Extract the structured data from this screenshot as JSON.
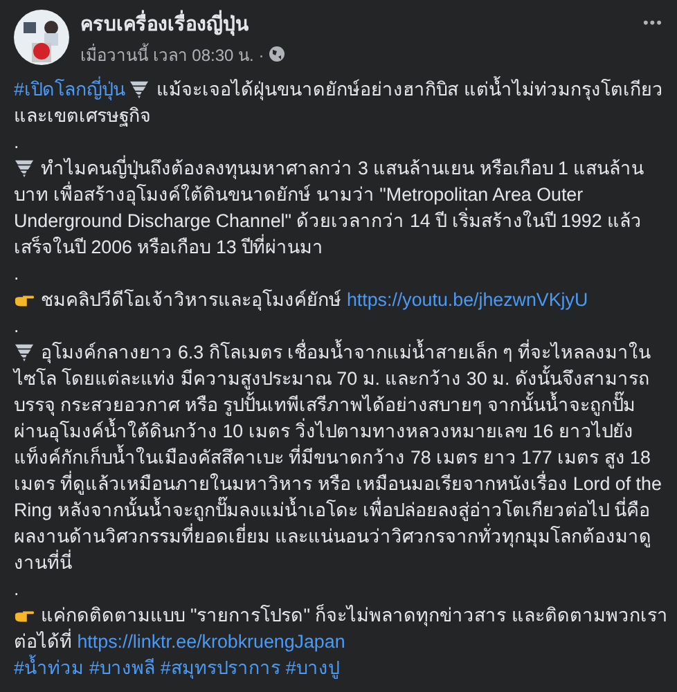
{
  "post": {
    "author": "ครบเครื่องเรื่องญี่ปุ่น",
    "time": "เมื่อวานนี้ เวลา 08:30 น. ·",
    "more": "•••",
    "paragraphs": [
      [
        {
          "kind": "hashtag",
          "text": "#เปิดโลกญี่ปุ่น"
        },
        {
          "kind": "tornado"
        },
        {
          "kind": "text",
          "text": " แม้จะเจอได้ฝุ่นขนาดยักษ์อย่างฮากิบิส แต่น้ำไม่ท่วมกรุงโตเกียวและเขตเศรษฐกิจ"
        }
      ],
      [
        {
          "kind": "text",
          "text": "."
        }
      ],
      [
        {
          "kind": "tornado"
        },
        {
          "kind": "text",
          "text": " ทำไมคนญี่ปุ่นถึงต้องลงทุนมหาศาลกว่า 3 แสนล้านเยน หรือเกือบ 1 แสนล้านบาท เพื่อสร้างอุโมงค์ใต้ดินขนาดยักษ์ นามว่า \"Metropolitan Area Outer Underground Discharge Channel\" ด้วยเวลากว่า 14 ปี เริ่มสร้างในปี 1992 แล้วเสร็จในปี 2006 หรือเกือบ 13 ปีที่ผ่านมา"
        }
      ],
      [
        {
          "kind": "text",
          "text": "."
        }
      ],
      [
        {
          "kind": "hand"
        },
        {
          "kind": "text",
          "text": " ชมคลิปวีดีโอเจ้าวิหารและอุโมงค์ยักษ์ "
        },
        {
          "kind": "link",
          "text": "https://youtu.be/jhezwnVKjyU"
        }
      ],
      [
        {
          "kind": "text",
          "text": "."
        }
      ],
      [
        {
          "kind": "tornado"
        },
        {
          "kind": "text",
          "text": " อุโมงค์กลางยาว 6.3 กิโลเมตร เชื่อมน้ำจากแม่น้ำสายเล็ก ๆ ที่จะไหลลงมาในไซโล โดยแต่ละแท่ง มีความสูงประมาณ 70 ม. และกว้าง 30 ม. ดังนั้นจึงสามารถบรรจุ กระสวยอวกาศ หรือ รูปปั้นเทพีเสรีภาพได้อย่างสบายๆ จากนั้นน้ำจะถูกปั๊มผ่านอุโมงค์น้ำใต้ดินกว้าง 10 เมตร วิ่งไปตามทางหลวงหมายเลข 16 ยาวไปยังแท็งค์กักเก็บน้ำในเมืองคัสสึคาเบะ ที่มีขนาดกว้าง 78 เมตร ยาว 177 เมตร สูง 18 เมตร ที่ดูแล้วเหมือนภายในมหาวิหาร หรือ เหมือนมอเรียจากหนังเรื่อง Lord of the Ring หลังจากนั้นน้ำจะถูกปั๊มลงแม่น้ำเอโดะ เพื่อปล่อยลงสู่อ่าวโตเกียวต่อไป นี่คือผลงานด้านวิศวกรรมที่ยอดเยี่ยม และแน่นอนว่าวิศวกรจากทั่วทุกมุมโลกต้องมาดูงานที่นี่"
        }
      ],
      [
        {
          "kind": "text",
          "text": "."
        }
      ],
      [
        {
          "kind": "hand"
        },
        {
          "kind": "text",
          "text": " แค่กดติดตามแบบ \"รายการโปรด\" ก็จะไม่พลาดทุกข่าวสาร และติดตามพวกเราต่อได้ที่ "
        },
        {
          "kind": "link",
          "text": "https://linktr.ee/krobkruengJapan"
        }
      ],
      [
        {
          "kind": "hashtag",
          "text": "#น้ำท่วม"
        },
        {
          "kind": "hashtag",
          "text": "#บางพลี"
        },
        {
          "kind": "hashtag",
          "text": "#สมุทรปราการ"
        },
        {
          "kind": "hashtag",
          "text": "#บางปู"
        }
      ]
    ]
  }
}
